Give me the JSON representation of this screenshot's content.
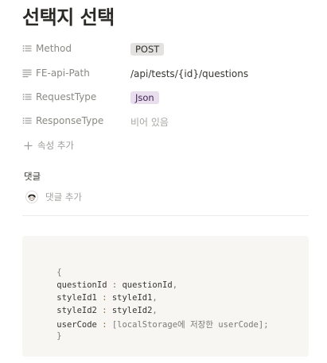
{
  "page": {
    "title": "선택지 선택"
  },
  "properties": [
    {
      "name": "Method",
      "value": "POST",
      "style": "tag-gray"
    },
    {
      "name": "FE-api-Path",
      "value": "/api/tests/{id}/questions",
      "style": "text"
    },
    {
      "name": "RequestType",
      "value": "Json",
      "style": "tag-purple"
    },
    {
      "name": "ResponseType",
      "value": "비어 있음",
      "style": "empty"
    }
  ],
  "add_property_label": "속성 추가",
  "comments": {
    "heading": "댓글",
    "add_placeholder": "댓글 추가"
  },
  "code": {
    "lines": [
      [
        "{"
      ],
      [
        "questionId",
        " : ",
        "questionId",
        ","
      ],
      [
        "styleId1",
        " : ",
        "styleId1",
        ","
      ],
      [
        "styleId2",
        " : ",
        "styleId2",
        ","
      ],
      [
        "userCode",
        " : ",
        "[localStorage에 저장한 userCode]",
        ";"
      ],
      [
        "}"
      ]
    ]
  },
  "colors": {
    "tag_gray_bg": "#e3e2e0",
    "tag_purple_bg": "#e8deee",
    "code_bg": "#f7f6f3"
  }
}
